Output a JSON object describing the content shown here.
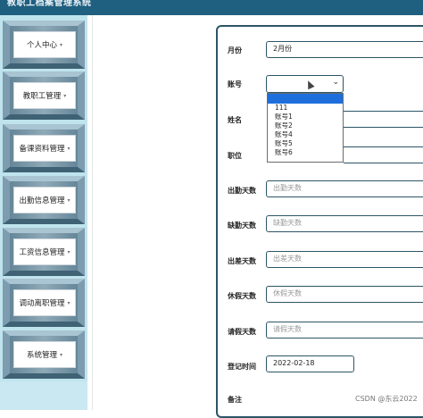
{
  "app": {
    "title": "教职工档案管理系统"
  },
  "sidebar": {
    "items": [
      {
        "label": "个人中心"
      },
      {
        "label": "教职工管理"
      },
      {
        "label": "备课资料管理"
      },
      {
        "label": "出勤信息管理"
      },
      {
        "label": "工资信息管理"
      },
      {
        "label": "调动离职管理"
      },
      {
        "label": "系统管理"
      }
    ]
  },
  "form": {
    "month": {
      "label": "月份",
      "value": "2月份"
    },
    "account": {
      "label": "账号",
      "value": "",
      "options": [
        "",
        "111",
        "账号1",
        "账号2",
        "账号4",
        "账号5",
        "账号6"
      ]
    },
    "name": {
      "label": "姓名"
    },
    "position": {
      "label": "职位"
    },
    "attendance_days": {
      "label": "出勤天数",
      "placeholder": "出勤天数"
    },
    "absence_days": {
      "label": "缺勤天数",
      "placeholder": "缺勤天数"
    },
    "trip_days": {
      "label": "出差天数",
      "placeholder": "出差天数"
    },
    "leave_days": {
      "label": "休假天数",
      "placeholder": "休假天数"
    },
    "sick_days": {
      "label": "请假天数",
      "placeholder": "请假天数"
    },
    "record_time": {
      "label": "登记时间",
      "value": "2022-02-18"
    },
    "remark": {
      "label": "备注"
    }
  },
  "watermark": "CSDN @东云2022",
  "colors": {
    "header": "#1f5f7f",
    "sidebar": "#bfe4ee",
    "border": "#2d5566",
    "highlight": "#1e6fdc"
  },
  "icons": {
    "caret": "chevron-down-icon",
    "select": "chevron-down-icon",
    "cursor": "mouse-pointer-icon"
  }
}
